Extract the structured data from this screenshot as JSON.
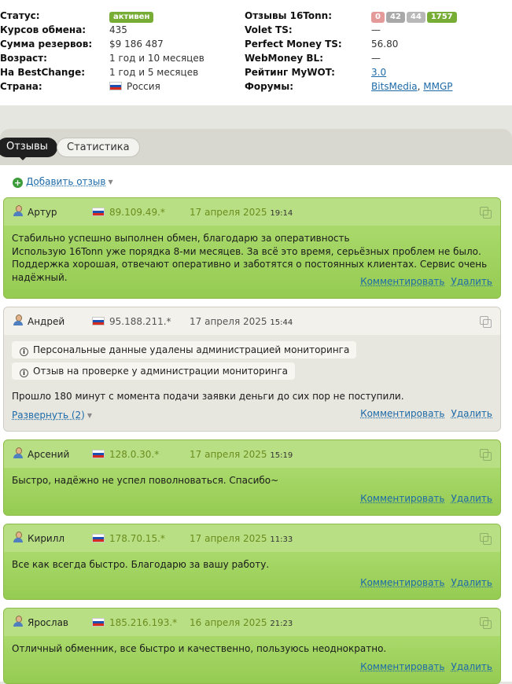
{
  "info": {
    "status_label": "Статус:",
    "status_value": "активен",
    "rates_label": "Курсов обмена:",
    "rates_value": "435",
    "reserves_label": "Сумма резервов:",
    "reserves_value": "$9 186 487",
    "age_label": "Возраст:",
    "age_value": "1 год и 10 месяцев",
    "bestchange_label": "На BestChange:",
    "bestchange_value": "1 год и 5 месяцев",
    "country_label": "Страна:",
    "country_value": "Россия",
    "reviews_label": "Отзывы 16Tonn:",
    "review_counts": [
      {
        "value": "0",
        "color": "#e59a9a"
      },
      {
        "value": "42",
        "color": "#a8a8a8"
      },
      {
        "value": "44",
        "color": "#b8b8b8"
      },
      {
        "value": "1757",
        "color": "#77ad35"
      }
    ],
    "volet_label": "Volet TS:",
    "volet_value": "—",
    "pm_label": "Perfect Money TS:",
    "pm_value": "56.80",
    "wm_label": "WebMoney BL:",
    "wm_value": "—",
    "mywot_label": "Рейтинг MyWOT:",
    "mywot_value": "3.0",
    "forums_label": "Форумы:",
    "forum_1": "BitsMedia",
    "forum_sep": ",",
    "forum_2": "MMGP"
  },
  "tabs": {
    "reviews": "Отзывы",
    "stats": "Статистика"
  },
  "add_review": "Добавить отзыв",
  "actions": {
    "comment": "Комментировать",
    "delete": "Удалить"
  },
  "reviews": [
    {
      "author": "Артур",
      "ip": "89.109.49.*",
      "date": "17 апреля 2025",
      "time": "19:14",
      "text_1": "Стабильно успешно выполнен обмен, благодарю за оперативность",
      "text_2": "Использую 16Tonn уже порядка 8-ми месяцев. За всё это время, серьёзных проблем не было. Поддержка хорошая, отвечают оперативно и заботятся о постоянных клиентах. Сервис очень надёжный."
    },
    {
      "author": "Андрей",
      "ip": "95.188.211.*",
      "date": "17 апреля 2025",
      "time": "15:44",
      "notice_1": "Персональные данные удалены администрацией мониторинга",
      "notice_2": "Отзыв на проверке у администрации мониторинга",
      "text": "Прошло 180 минут с момента подачи заявки деньги до сих пор не поступили.",
      "expand": "Развернуть (2)"
    },
    {
      "author": "Арсений",
      "ip": "128.0.30.*",
      "date": "17 апреля 2025",
      "time": "15:19",
      "text": "Быстро, надёжно не успел поволноваться. Спасибо~"
    },
    {
      "author": "Кирилл",
      "ip": "178.70.15.*",
      "date": "17 апреля 2025",
      "time": "11:33",
      "text": "Все как всегда быстро. Благодарю за вашу работу."
    },
    {
      "author": "Ярослав",
      "ip": "185.216.193.*",
      "date": "16 апреля 2025",
      "time": "21:23",
      "text": "Отличный обменник, все быстро и качественно, пользуюсь неоднократно."
    }
  ]
}
